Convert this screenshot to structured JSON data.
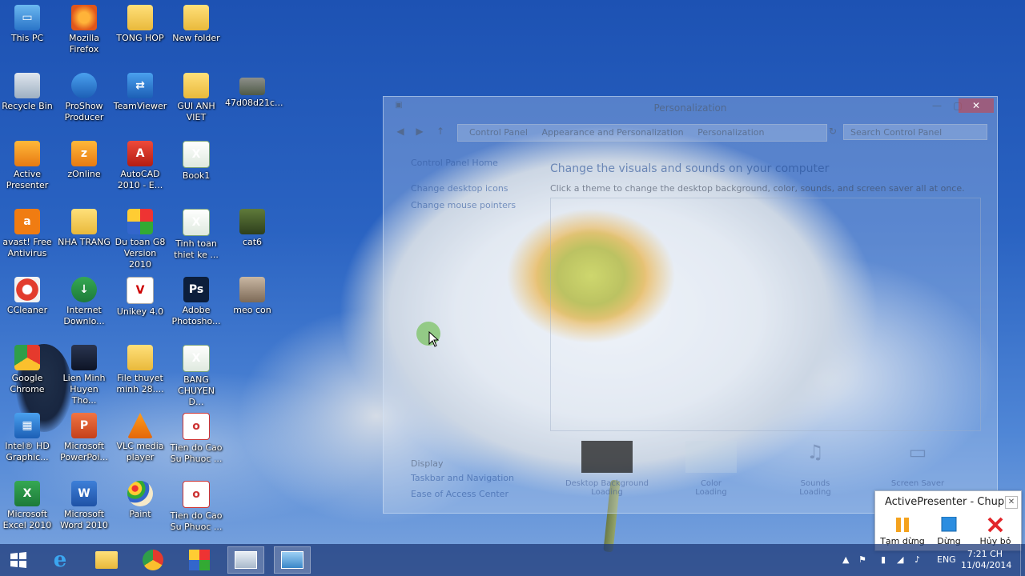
{
  "desktop_icons": [
    {
      "label": "This PC",
      "icon": "computer-icon"
    },
    {
      "label": "Mozilla Firefox",
      "icon": "firefox-icon"
    },
    {
      "label": "TONG HOP",
      "icon": "folder-icon"
    },
    {
      "label": "New folder",
      "icon": "folder-icon"
    },
    {
      "label": "Recycle Bin",
      "icon": "recycle-bin-icon"
    },
    {
      "label": "ProShow Producer",
      "icon": "proshow-icon"
    },
    {
      "label": "TeamViewer",
      "icon": "teamviewer-icon"
    },
    {
      "label": "GUI ANH VIET",
      "icon": "folder-icon"
    },
    {
      "label": "47d08d21c...",
      "icon": "image-file-icon"
    },
    {
      "label": "Active Presenter",
      "icon": "activepresenter-icon"
    },
    {
      "label": "zOnline",
      "icon": "zonline-icon"
    },
    {
      "label": "AutoCAD 2010 - E...",
      "icon": "autocad-icon"
    },
    {
      "label": "Book1",
      "icon": "excel-file-icon"
    },
    {
      "label": "avast! Free Antivirus",
      "icon": "avast-icon"
    },
    {
      "label": "NHA TRANG",
      "icon": "folder-icon"
    },
    {
      "label": "Du toan G8 Version 2010",
      "icon": "dutoan-icon"
    },
    {
      "label": "Tinh toan thiet ke ...",
      "icon": "excel-file-icon"
    },
    {
      "label": "cat6",
      "icon": "image-file-icon"
    },
    {
      "label": "CCleaner",
      "icon": "ccleaner-icon"
    },
    {
      "label": "Internet Downlo...",
      "icon": "idm-icon"
    },
    {
      "label": "Unikey 4.0",
      "icon": "unikey-icon"
    },
    {
      "label": "Adobe Photosho...",
      "icon": "photoshop-icon"
    },
    {
      "label": "meo con",
      "icon": "image-file-icon"
    },
    {
      "label": "Google Chrome",
      "icon": "chrome-icon"
    },
    {
      "label": "Lien Minh Huyen Tho...",
      "icon": "game-icon"
    },
    {
      "label": "File thuyet minh 28....",
      "icon": "folder-icon"
    },
    {
      "label": "BANG CHUYEN D...",
      "icon": "excel-file-icon"
    },
    {
      "label": "Intel® HD Graphic...",
      "icon": "intel-graphics-icon"
    },
    {
      "label": "Microsoft PowerPoi...",
      "icon": "powerpoint-icon"
    },
    {
      "label": "VLC media player",
      "icon": "vlc-icon"
    },
    {
      "label": "Tien do Cao Su Phuoc ...",
      "icon": "office-file-icon"
    },
    {
      "label": "Microsoft Excel 2010",
      "icon": "excel-icon"
    },
    {
      "label": "Microsoft Word 2010",
      "icon": "word-icon"
    },
    {
      "label": "Paint",
      "icon": "paint-icon"
    },
    {
      "label": "Tien do Cao Su Phuoc ...",
      "icon": "office-file-icon"
    }
  ],
  "personalization_window": {
    "title": "Personalization",
    "breadcrumb": [
      "Control Panel",
      "Appearance and Personalization",
      "Personalization"
    ],
    "search_placeholder": "Search Control Panel",
    "side_links": [
      "Control Panel Home",
      "Change desktop icons",
      "Change mouse pointers"
    ],
    "see_also": [
      "Display",
      "Taskbar and Navigation",
      "Ease of Access Center"
    ],
    "heading": "Change the visuals and sounds on your computer",
    "subheading": "Click a theme to change the desktop background, color, sounds, and screen saver all at once.",
    "bottom_items": [
      {
        "label": "Desktop Background",
        "status": "Loading"
      },
      {
        "label": "Color",
        "status": "Loading"
      },
      {
        "label": "Sounds",
        "status": "Loading"
      },
      {
        "label": "Screen Saver",
        "status": ""
      }
    ]
  },
  "active_presenter": {
    "title": "ActivePresenter - Chup",
    "buttons": [
      {
        "label": "Tạm dừng",
        "icon": "pause-icon",
        "color": "#f4a21d"
      },
      {
        "label": "Dừng",
        "icon": "stop-icon",
        "color": "#2b8de0"
      },
      {
        "label": "Hủy bỏ",
        "icon": "cancel-icon",
        "color": "#e2262a"
      }
    ]
  },
  "taskbar": {
    "items": [
      "start-icon",
      "internet-explorer-icon",
      "file-explorer-icon",
      "chrome-icon",
      "dutoan-icon",
      "photos-icon",
      "control-panel-icon"
    ],
    "language": "ENG",
    "time": "7:21 CH",
    "date": "11/04/2014"
  }
}
